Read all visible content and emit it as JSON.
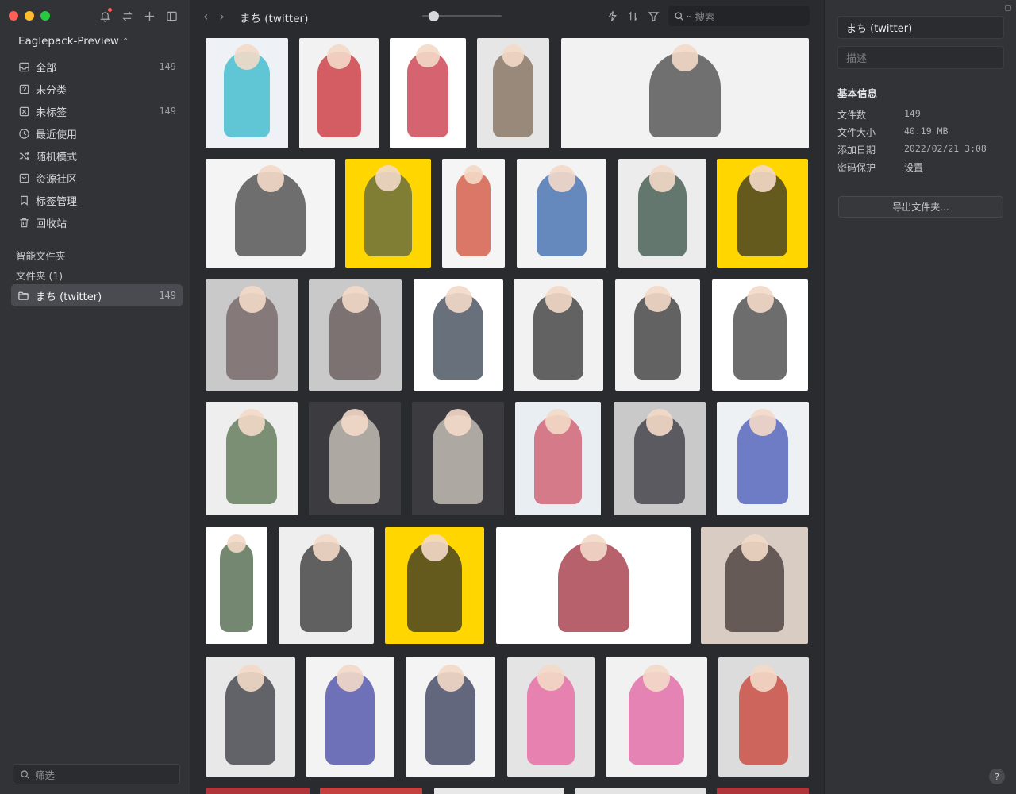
{
  "sidebar": {
    "library_name": "Eaglepack-Preview",
    "nav": [
      {
        "key": "all",
        "label": "全部",
        "count": "149",
        "icon": "inbox-icon"
      },
      {
        "key": "uncategorized",
        "label": "未分类",
        "count": "",
        "icon": "question-box-icon"
      },
      {
        "key": "untagged",
        "label": "未标签",
        "count": "149",
        "icon": "tag-off-icon"
      },
      {
        "key": "recent",
        "label": "最近使用",
        "count": "",
        "icon": "clock-icon"
      },
      {
        "key": "random",
        "label": "随机模式",
        "count": "",
        "icon": "shuffle-icon"
      },
      {
        "key": "community",
        "label": "资源社区",
        "count": "",
        "icon": "community-icon"
      },
      {
        "key": "tags",
        "label": "标签管理",
        "count": "",
        "icon": "bookmark-icon"
      },
      {
        "key": "trash",
        "label": "回收站",
        "count": "",
        "icon": "trash-icon"
      }
    ],
    "smart_folders_title": "智能文件夹",
    "folders_title": "文件夹 (1)",
    "folder": {
      "label": "まち (twitter)",
      "count": "149"
    },
    "filter_placeholder": "筛选"
  },
  "toolbar": {
    "breadcrumb": "まち (twitter)",
    "zoom_level": 0.1,
    "search_placeholder": "搜索"
  },
  "panel": {
    "name_value": "まち (twitter)",
    "desc_placeholder": "描述",
    "info_title": "基本信息",
    "info": [
      {
        "key": "文件数",
        "value": "149"
      },
      {
        "key": "文件大小",
        "value": "40.19 MB"
      },
      {
        "key": "添加日期",
        "value": "2022/02/21 3:08"
      },
      {
        "key": "密码保护",
        "value": "设置"
      }
    ],
    "export_label": "导出文件夹...",
    "help_label": "?"
  },
  "colors": {
    "accent_yellow": "#ffd600",
    "traffic_red": "#ff5f57",
    "traffic_yellow": "#febc2e",
    "traffic_green": "#28c840"
  }
}
